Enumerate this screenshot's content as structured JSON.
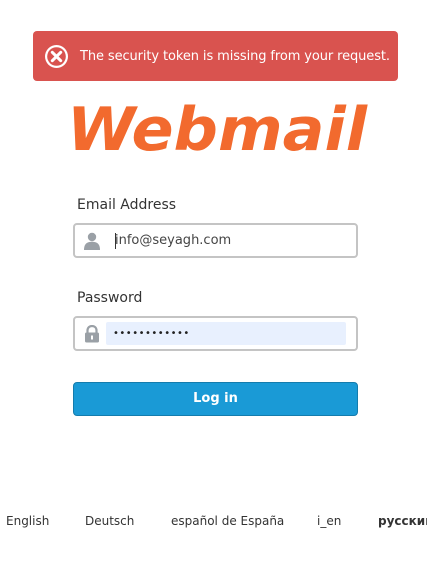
{
  "alert": {
    "icon": "error-circle-x-icon",
    "message": "The security token is missing from your request.",
    "background": "#d9534f"
  },
  "logo": {
    "text": "Webmail",
    "color": "#f26a2e"
  },
  "form": {
    "email_label": "Email Address",
    "email_value": "info@seyagh.com",
    "email_icon": "user-icon",
    "password_label": "Password",
    "password_mask": "••••••••••••",
    "password_icon": "lock-icon",
    "login_label": "Log in",
    "login_color": "#1a9ad6"
  },
  "languages": [
    "English",
    "Deutsch",
    "español de España",
    "i_en",
    "русский"
  ]
}
